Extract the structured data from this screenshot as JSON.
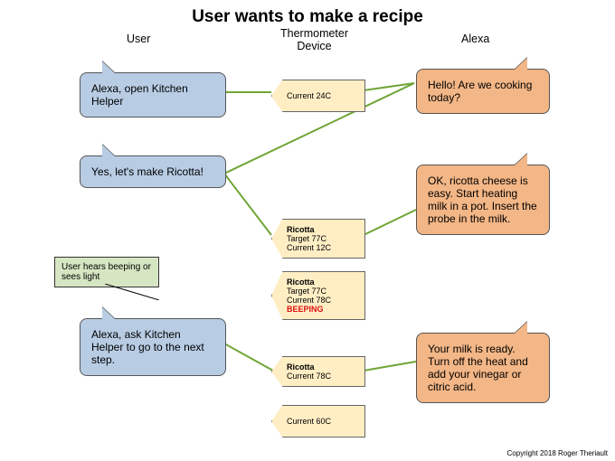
{
  "title": "User wants to make a recipe",
  "columns": {
    "user": "User",
    "device": "Thermometer\nDevice",
    "alexa": "Alexa"
  },
  "user_bubbles": {
    "u1": "Alexa, open Kitchen Helper",
    "u2": "Yes, let's make Ricotta!",
    "u3": "Alexa, ask Kitchen Helper to go to the next step."
  },
  "alexa_bubbles": {
    "a1": "Hello! Are we cooking today?",
    "a2": "OK, ricotta cheese is easy. Start heating milk in a pot. Insert the probe in the milk.",
    "a3": "Your milk is ready. Turn off the heat and add your vinegar or citric acid."
  },
  "devices": {
    "d1": {
      "lines": [
        "Current 24C"
      ]
    },
    "d2": {
      "title": "Ricotta",
      "lines": [
        "Target 77C",
        "Current 12C"
      ]
    },
    "d3": {
      "title": "Ricotta",
      "lines": [
        "Target 77C",
        "Current 78C"
      ],
      "alarm": "BEEPING"
    },
    "d4": {
      "title": "Ricotta",
      "lines": [
        "Current 78C"
      ]
    },
    "d5": {
      "lines": [
        "Current 60C"
      ]
    }
  },
  "note": "User hears beeping or sees light",
  "copyright": "Copyright 2018 Roger Theriault"
}
